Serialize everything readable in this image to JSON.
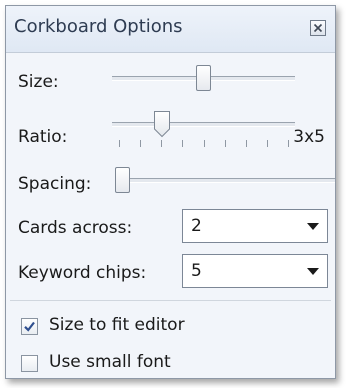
{
  "panel": {
    "title": "Corkboard Options"
  },
  "controls": {
    "size": {
      "label": "Size:",
      "level": 0.5
    },
    "ratio": {
      "label": "Ratio:",
      "value": "3x5",
      "level": 0.25,
      "tick_count": 9
    },
    "spacing": {
      "label": "Spacing:",
      "level": 0.0
    },
    "cards_across": {
      "label": "Cards across:",
      "value": "2"
    },
    "keyword_chips": {
      "label": "Keyword chips:",
      "value": "5"
    }
  },
  "checkboxes": [
    {
      "label": "Size to fit editor",
      "checked": true
    },
    {
      "label": "Use small font",
      "checked": false
    }
  ],
  "icons": {
    "close": "close-icon",
    "dropdown": "chevron-down-icon",
    "check": "checkmark-icon"
  },
  "colors": {
    "title_text": "#2e3c52",
    "check_mark": "#2f4f8f"
  }
}
